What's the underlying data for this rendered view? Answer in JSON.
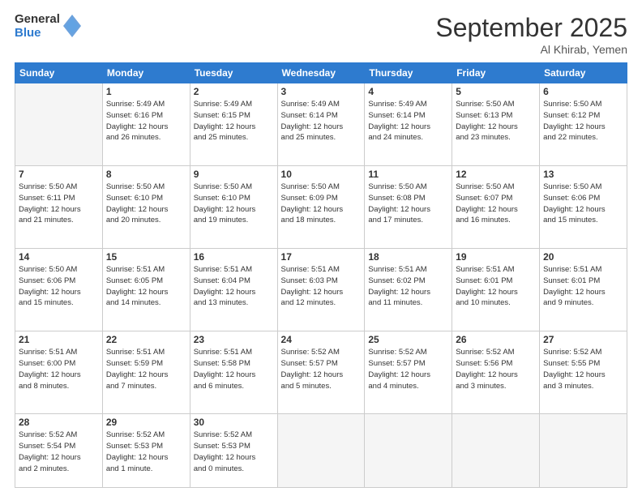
{
  "logo": {
    "general": "General",
    "blue": "Blue"
  },
  "title": {
    "month": "September 2025",
    "location": "Al Khirab, Yemen"
  },
  "weekdays": [
    "Sunday",
    "Monday",
    "Tuesday",
    "Wednesday",
    "Thursday",
    "Friday",
    "Saturday"
  ],
  "weeks": [
    [
      {
        "day": "",
        "info": ""
      },
      {
        "day": "1",
        "info": "Sunrise: 5:49 AM\nSunset: 6:16 PM\nDaylight: 12 hours\nand 26 minutes."
      },
      {
        "day": "2",
        "info": "Sunrise: 5:49 AM\nSunset: 6:15 PM\nDaylight: 12 hours\nand 25 minutes."
      },
      {
        "day": "3",
        "info": "Sunrise: 5:49 AM\nSunset: 6:14 PM\nDaylight: 12 hours\nand 25 minutes."
      },
      {
        "day": "4",
        "info": "Sunrise: 5:49 AM\nSunset: 6:14 PM\nDaylight: 12 hours\nand 24 minutes."
      },
      {
        "day": "5",
        "info": "Sunrise: 5:50 AM\nSunset: 6:13 PM\nDaylight: 12 hours\nand 23 minutes."
      },
      {
        "day": "6",
        "info": "Sunrise: 5:50 AM\nSunset: 6:12 PM\nDaylight: 12 hours\nand 22 minutes."
      }
    ],
    [
      {
        "day": "7",
        "info": "Sunrise: 5:50 AM\nSunset: 6:11 PM\nDaylight: 12 hours\nand 21 minutes."
      },
      {
        "day": "8",
        "info": "Sunrise: 5:50 AM\nSunset: 6:10 PM\nDaylight: 12 hours\nand 20 minutes."
      },
      {
        "day": "9",
        "info": "Sunrise: 5:50 AM\nSunset: 6:10 PM\nDaylight: 12 hours\nand 19 minutes."
      },
      {
        "day": "10",
        "info": "Sunrise: 5:50 AM\nSunset: 6:09 PM\nDaylight: 12 hours\nand 18 minutes."
      },
      {
        "day": "11",
        "info": "Sunrise: 5:50 AM\nSunset: 6:08 PM\nDaylight: 12 hours\nand 17 minutes."
      },
      {
        "day": "12",
        "info": "Sunrise: 5:50 AM\nSunset: 6:07 PM\nDaylight: 12 hours\nand 16 minutes."
      },
      {
        "day": "13",
        "info": "Sunrise: 5:50 AM\nSunset: 6:06 PM\nDaylight: 12 hours\nand 15 minutes."
      }
    ],
    [
      {
        "day": "14",
        "info": "Sunrise: 5:50 AM\nSunset: 6:06 PM\nDaylight: 12 hours\nand 15 minutes."
      },
      {
        "day": "15",
        "info": "Sunrise: 5:51 AM\nSunset: 6:05 PM\nDaylight: 12 hours\nand 14 minutes."
      },
      {
        "day": "16",
        "info": "Sunrise: 5:51 AM\nSunset: 6:04 PM\nDaylight: 12 hours\nand 13 minutes."
      },
      {
        "day": "17",
        "info": "Sunrise: 5:51 AM\nSunset: 6:03 PM\nDaylight: 12 hours\nand 12 minutes."
      },
      {
        "day": "18",
        "info": "Sunrise: 5:51 AM\nSunset: 6:02 PM\nDaylight: 12 hours\nand 11 minutes."
      },
      {
        "day": "19",
        "info": "Sunrise: 5:51 AM\nSunset: 6:01 PM\nDaylight: 12 hours\nand 10 minutes."
      },
      {
        "day": "20",
        "info": "Sunrise: 5:51 AM\nSunset: 6:01 PM\nDaylight: 12 hours\nand 9 minutes."
      }
    ],
    [
      {
        "day": "21",
        "info": "Sunrise: 5:51 AM\nSunset: 6:00 PM\nDaylight: 12 hours\nand 8 minutes."
      },
      {
        "day": "22",
        "info": "Sunrise: 5:51 AM\nSunset: 5:59 PM\nDaylight: 12 hours\nand 7 minutes."
      },
      {
        "day": "23",
        "info": "Sunrise: 5:51 AM\nSunset: 5:58 PM\nDaylight: 12 hours\nand 6 minutes."
      },
      {
        "day": "24",
        "info": "Sunrise: 5:52 AM\nSunset: 5:57 PM\nDaylight: 12 hours\nand 5 minutes."
      },
      {
        "day": "25",
        "info": "Sunrise: 5:52 AM\nSunset: 5:57 PM\nDaylight: 12 hours\nand 4 minutes."
      },
      {
        "day": "26",
        "info": "Sunrise: 5:52 AM\nSunset: 5:56 PM\nDaylight: 12 hours\nand 3 minutes."
      },
      {
        "day": "27",
        "info": "Sunrise: 5:52 AM\nSunset: 5:55 PM\nDaylight: 12 hours\nand 3 minutes."
      }
    ],
    [
      {
        "day": "28",
        "info": "Sunrise: 5:52 AM\nSunset: 5:54 PM\nDaylight: 12 hours\nand 2 minutes."
      },
      {
        "day": "29",
        "info": "Sunrise: 5:52 AM\nSunset: 5:53 PM\nDaylight: 12 hours\nand 1 minute."
      },
      {
        "day": "30",
        "info": "Sunrise: 5:52 AM\nSunset: 5:53 PM\nDaylight: 12 hours\nand 0 minutes."
      },
      {
        "day": "",
        "info": ""
      },
      {
        "day": "",
        "info": ""
      },
      {
        "day": "",
        "info": ""
      },
      {
        "day": "",
        "info": ""
      }
    ]
  ]
}
